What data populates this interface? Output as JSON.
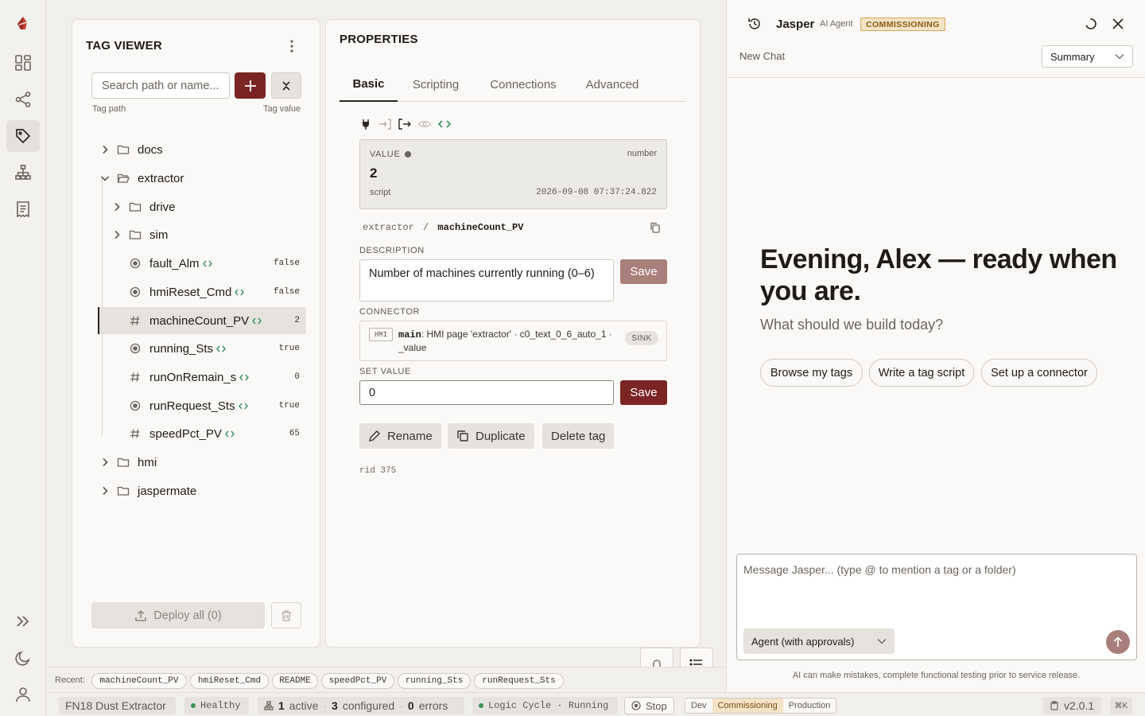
{
  "tag_viewer": {
    "title": "TAG VIEWER",
    "search_placeholder": "Search path or name...",
    "col_path": "Tag path",
    "col_value": "Tag value",
    "deploy_label": "Deploy all (0)",
    "tree": [
      {
        "label": "docs",
        "type": "folder",
        "state": "collapsed"
      },
      {
        "label": "extractor",
        "type": "folder",
        "state": "expanded"
      },
      {
        "label": "drive",
        "type": "folder",
        "state": "collapsed"
      },
      {
        "label": "sim",
        "type": "folder",
        "state": "collapsed"
      },
      {
        "label": "fault_Alm",
        "type": "bool",
        "value": "false"
      },
      {
        "label": "hmiReset_Cmd",
        "type": "bool",
        "value": "false"
      },
      {
        "label": "machineCount_PV",
        "type": "number",
        "value": "2"
      },
      {
        "label": "running_Sts",
        "type": "bool",
        "value": "true"
      },
      {
        "label": "runOnRemain_s",
        "type": "number",
        "value": "0"
      },
      {
        "label": "runRequest_Sts",
        "type": "bool",
        "value": "true"
      },
      {
        "label": "speedPct_PV",
        "type": "number",
        "value": "65"
      },
      {
        "label": "hmi",
        "type": "folder",
        "state": "collapsed"
      },
      {
        "label": "jaspermate",
        "type": "folder",
        "state": "collapsed"
      }
    ]
  },
  "properties": {
    "title": "PROPERTIES",
    "tabs": [
      "Basic",
      "Scripting",
      "Connections",
      "Advanced"
    ],
    "value_card": {
      "label": "VALUE",
      "type": "number",
      "value": "2",
      "source": "script",
      "timestamp": "2026-09-08 07:37:24.822"
    },
    "path_parent": "extractor",
    "path_sep": "/",
    "path_name": "machineCount_PV",
    "description_label": "DESCRIPTION",
    "description": "Number of machines currently running (0–6)",
    "save_label": "Save",
    "connector_label": "CONNECTOR",
    "connector": {
      "kind": "HMI",
      "name": "main",
      "detail": ": HMI page 'extractor' · c0_text_0_6_auto_1 · _value",
      "direction": "SINK"
    },
    "set_value_label": "SET VALUE",
    "set_value": "0",
    "rename_label": "Rename",
    "duplicate_label": "Duplicate",
    "delete_label": "Delete tag",
    "rid": "rid 375"
  },
  "recent": {
    "label": "Recent:",
    "items": [
      "machineCount_PV",
      "hmiReset_Cmd",
      "README",
      "speedPct_PV",
      "running_Sts",
      "runRequest_Sts"
    ]
  },
  "status_bar": {
    "project": "FN18 Dust Extractor",
    "health": "Healthy",
    "active_count": "1",
    "active_label": "active",
    "configured_count": "3",
    "configured_label": "configured",
    "error_count": "0",
    "error_label": "errors",
    "logic_cycle": "Logic Cycle · Running",
    "stop_label": "Stop",
    "envs": [
      "Dev",
      "Commissioning",
      "Production"
    ],
    "version": "v2.0.1",
    "shortcut": "⌘K"
  },
  "agent": {
    "name": "Jasper",
    "subtitle": "AI Agent",
    "badge": "COMMISSIONING",
    "new_chat": "New Chat",
    "view_select": "Summary",
    "greeting": "Evening, Alex — ready when you are.",
    "prompt": "What should we build today?",
    "suggestions": [
      "Browse my tags",
      "Write a tag script",
      "Set up a connector"
    ],
    "composer_placeholder": "Message Jasper... (type @ to mention a tag or a folder)",
    "mode": "Agent (with approvals)",
    "disclaimer": "AI can make mistakes, complete functional testing prior to service release."
  },
  "colors": {
    "accent": "#7a2424",
    "badge_bg": "#f4e3c6",
    "ok_green": "#3a9160"
  }
}
